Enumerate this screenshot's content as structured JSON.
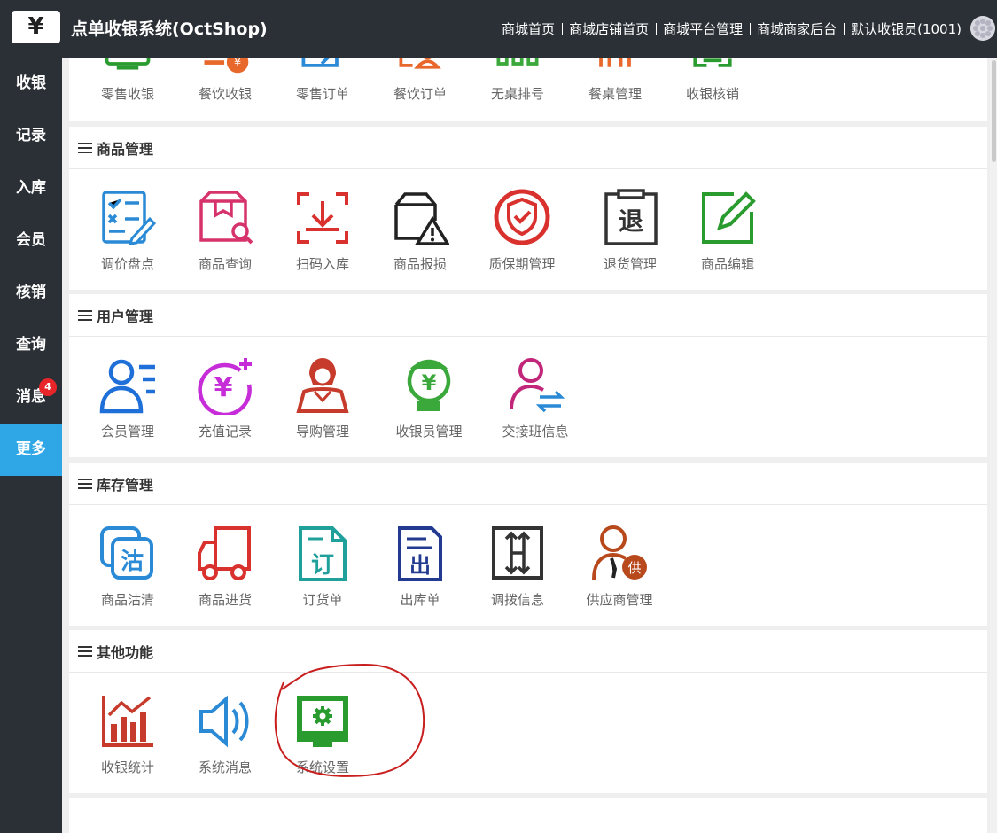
{
  "header": {
    "logo_glyph": "¥",
    "title": "点单收银系统(OctShop)",
    "nav": [
      "商城首页",
      "商城店铺首页",
      "商城平台管理",
      "商城商家后台",
      "默认收银员(1001)"
    ]
  },
  "sidebar": {
    "items": [
      {
        "label": "收银"
      },
      {
        "label": "记录"
      },
      {
        "label": "入库"
      },
      {
        "label": "会员"
      },
      {
        "label": "核销"
      },
      {
        "label": "查询"
      },
      {
        "label": "消息",
        "badge": "4"
      },
      {
        "label": "更多",
        "active": true
      }
    ]
  },
  "top_row": [
    "零售收银",
    "餐饮收银",
    "零售订单",
    "餐饮订单",
    "无桌排号",
    "餐桌管理",
    "收银核销"
  ],
  "sections": [
    {
      "title": "商品管理",
      "items": [
        {
          "label": "调价盘点",
          "icon": "price-check-icon",
          "color": "#2b8ad6"
        },
        {
          "label": "商品查询",
          "icon": "product-search-icon",
          "color": "#d6336c"
        },
        {
          "label": "扫码入库",
          "icon": "scan-import-icon",
          "color": "#d9322e"
        },
        {
          "label": "商品报损",
          "icon": "damage-report-icon",
          "color": "#222222"
        },
        {
          "label": "质保期管理",
          "icon": "warranty-shield-icon",
          "color": "#d9322e"
        },
        {
          "label": "退货管理",
          "icon": "return-clipboard-icon",
          "color": "#333333"
        },
        {
          "label": "商品编辑",
          "icon": "edit-icon",
          "color": "#2a9b2f"
        }
      ]
    },
    {
      "title": "用户管理",
      "items": [
        {
          "label": "会员管理",
          "icon": "member-list-icon",
          "color": "#1f6fd8"
        },
        {
          "label": "充值记录",
          "icon": "recharge-yen-icon",
          "color": "#c62cd8"
        },
        {
          "label": "导购管理",
          "icon": "shopping-guide-icon",
          "color": "#c63b2b"
        },
        {
          "label": "收银员管理",
          "icon": "cashier-icon",
          "color": "#3aa83a"
        },
        {
          "label": "交接班信息",
          "icon": "shift-handover-icon",
          "color": "#c2267a"
        }
      ]
    },
    {
      "title": "库存管理",
      "items": [
        {
          "label": "商品沽清",
          "icon": "sold-out-icon",
          "color": "#2b8ad6"
        },
        {
          "label": "商品进货",
          "icon": "truck-icon",
          "color": "#d9322e"
        },
        {
          "label": "订货单",
          "icon": "order-doc-icon",
          "color": "#1fa09a"
        },
        {
          "label": "出库单",
          "icon": "outbound-doc-icon",
          "color": "#223a8f"
        },
        {
          "label": "调拨信息",
          "icon": "transfer-icon",
          "color": "#333333"
        },
        {
          "label": "供应商管理",
          "icon": "supplier-icon",
          "color": "#b8491d"
        }
      ]
    },
    {
      "title": "其他功能",
      "items": [
        {
          "label": "收银统计",
          "icon": "bar-chart-icon",
          "color": "#c63b2b"
        },
        {
          "label": "系统消息",
          "icon": "speaker-icon",
          "color": "#2b8ad6"
        },
        {
          "label": "系统设置",
          "icon": "settings-monitor-icon",
          "color": "#2a9b2f"
        }
      ]
    }
  ],
  "glyphs": {
    "return": "退",
    "sold_out": "沽",
    "order": "订",
    "outbound": "出",
    "supplier": "供",
    "yen": "¥"
  },
  "colors": {
    "sidebar_bg": "#2b3036",
    "accent": "#2fa7e6",
    "badge": "#e8262a",
    "annotation": "#c81e1e"
  }
}
